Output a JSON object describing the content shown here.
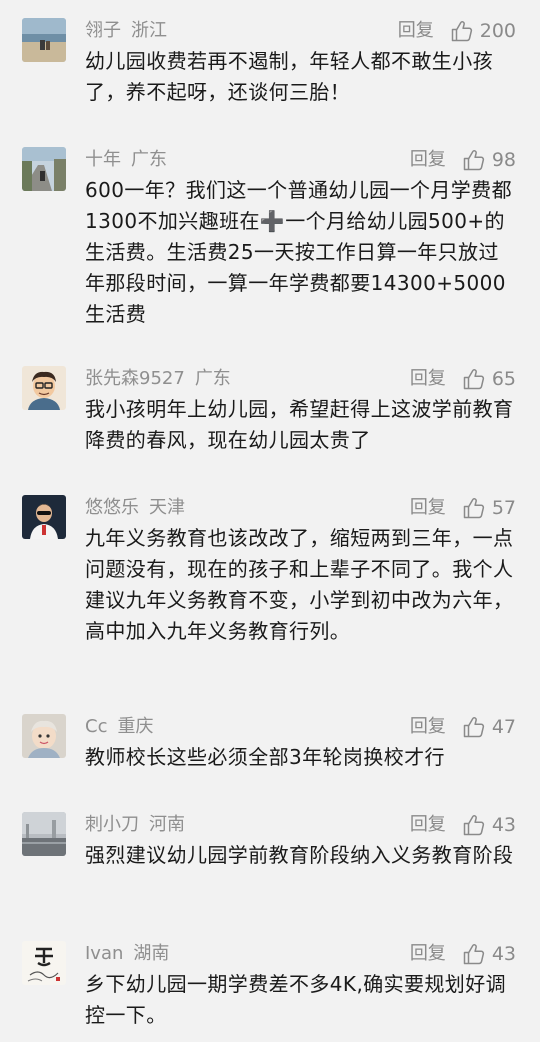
{
  "comments": [
    {
      "username": "翎子",
      "location": "浙江",
      "reply_label": "回复",
      "likes": "200",
      "text": "幼儿园收费若再不遏制，年轻人都不敢生小孩了，养不起呀，还谈何三胎！",
      "avatar_icon": "beach-photo-avatar"
    },
    {
      "username": "十年",
      "location": "广东",
      "reply_label": "回复",
      "likes": "98",
      "text": "600一年？我们这一个普通幼儿园一个月学费都1300不加兴趣班在➕一个月给幼儿园500+的生活费。生活费25一天按工作日算一年只放过年那段时间，一算一年学费都要14300+5000生活费",
      "avatar_icon": "street-photo-avatar"
    },
    {
      "username": "张先森9527",
      "location": "广东",
      "reply_label": "回复",
      "likes": "65",
      "text": "我小孩明年上幼儿园，希望赶得上这波学前教育降费的春风，现在幼儿园太贵了",
      "avatar_icon": "cartoon-man-avatar"
    },
    {
      "username": "悠悠乐",
      "location": "天津",
      "reply_label": "回复",
      "likes": "57",
      "text": "九年义务教育也该改改了，缩短两到三年，一点问题没有，现在的孩子和上辈子不同了。我个人建议九年义务教育不变，小学到初中改为六年，高中加入九年义务教育行列。",
      "avatar_icon": "person-dark-avatar"
    },
    {
      "username": "Cc",
      "location": "重庆",
      "reply_label": "回复",
      "likes": "47",
      "text": "教师校长这些必须全部3年轮岗换校才行",
      "avatar_icon": "baby-photo-avatar"
    },
    {
      "username": "刺小刀",
      "location": "河南",
      "reply_label": "回复",
      "likes": "43",
      "text": "强烈建议幼儿园学前教育阶段纳入义务教育阶段",
      "avatar_icon": "foggy-landscape-avatar"
    },
    {
      "username": "Ivan",
      "location": "湖南",
      "reply_label": "回复",
      "likes": "43",
      "text": "乡下幼儿园一期学费差不多4K,确实要规划好调控一下。",
      "avatar_icon": "calligraphy-avatar"
    }
  ],
  "colors": {
    "background": "#f2f2f2",
    "meta_text": "#8f8f8f",
    "body_text": "#1a1a1a"
  }
}
